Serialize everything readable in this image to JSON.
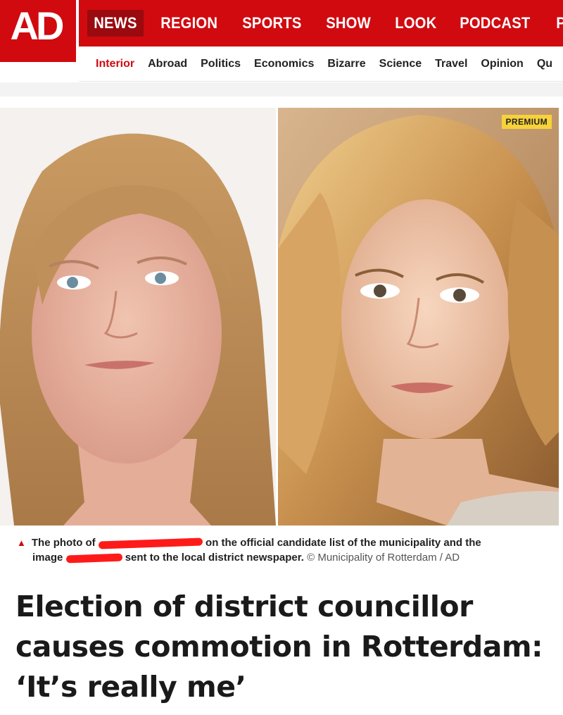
{
  "header": {
    "logo": "AD",
    "main_nav": [
      "NEWS",
      "REGION",
      "SPORTS",
      "SHOW",
      "LOOK",
      "PODCAST",
      "PUZ"
    ],
    "active_main": "NEWS",
    "sub_nav": [
      "Interior",
      "Abroad",
      "Politics",
      "Economics",
      "Bizarre",
      "Science",
      "Travel",
      "Opinion",
      "Qu"
    ],
    "active_sub": "Interior",
    "colors": {
      "brand_red": "#d10a10",
      "active_tab": "#9a0a0f",
      "premium_yellow": "#f7d23a"
    }
  },
  "photos": {
    "left": {
      "icon": "portrait-photo"
    },
    "right": {
      "icon": "portrait-photo",
      "badge": "PREMIUM"
    }
  },
  "caption": {
    "part1": "The photo of",
    "part2": "on the official candidate list of the municipality and the",
    "part3": "image",
    "part4": "sent to the local district newspaper.",
    "credit": "© Municipality of Rotterdam / AD"
  },
  "headline": {
    "line1": "Election of district councillor",
    "line2": "causes commotion in Rotterdam:",
    "line3": "‘It’s really me’"
  }
}
